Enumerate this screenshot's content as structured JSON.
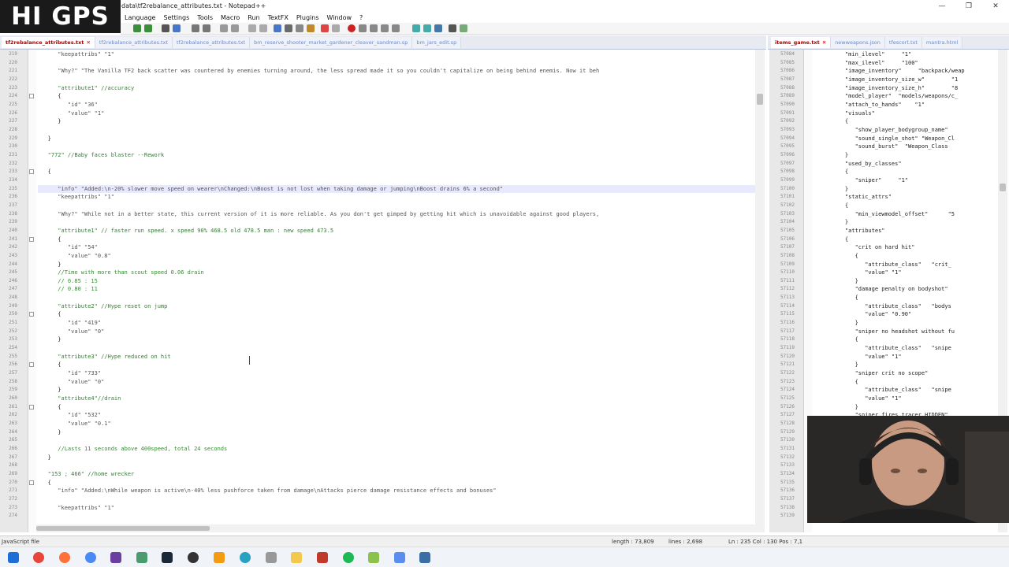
{
  "window": {
    "title": "data\\tf2rebalance_attributes.txt - Notepad++",
    "buttons": [
      "—",
      "❐",
      "✕"
    ]
  },
  "logo": {
    "text": "HI GPS"
  },
  "menu": [
    "Language",
    "Settings",
    "Tools",
    "Macro",
    "Run",
    "TextFX",
    "Plugins",
    "Window",
    "?"
  ],
  "left_tabs": [
    {
      "label": "tf2rebalance_attributes.txt",
      "active": true
    },
    {
      "label": "tf2rebalance_attributes.txt",
      "active": false
    },
    {
      "label": "tf2rebalance_attributes.txt",
      "active": false
    },
    {
      "label": "bm_reserve_shooter_market_gardener_cleaver_sandman.sp",
      "active": false
    },
    {
      "label": "bm_jars_edit.sp",
      "active": false
    }
  ],
  "right_tabs": [
    {
      "label": "items_game.txt",
      "active": true
    },
    {
      "label": "newweapons.json",
      "active": false
    },
    {
      "label": "tfescort.txt",
      "active": false
    },
    {
      "label": "mantra.html",
      "active": false
    }
  ],
  "left_code": [
    {
      "n": "219",
      "t": "      \"keepattribs\" \"1\"",
      "c": "str"
    },
    {
      "n": "220",
      "t": "",
      "c": ""
    },
    {
      "n": "221",
      "t": "      \"Why?\" \"The Vanilla TF2 back scatter was countered by enemies turning around, the less spread made it so you couldn't capitalize on being behind enemis. Now it beh",
      "c": "str"
    },
    {
      "n": "222",
      "t": "",
      "c": ""
    },
    {
      "n": "223",
      "t": "      \"attribute1\" //accuracy",
      "c": "mix1"
    },
    {
      "n": "224",
      "t": "      {",
      "c": ""
    },
    {
      "n": "225",
      "t": "         \"id\" \"36\"",
      "c": "str"
    },
    {
      "n": "226",
      "t": "         \"value\" \"1\"",
      "c": "str"
    },
    {
      "n": "227",
      "t": "      }",
      "c": ""
    },
    {
      "n": "228",
      "t": "",
      "c": ""
    },
    {
      "n": "229",
      "t": "   }",
      "c": ""
    },
    {
      "n": "230",
      "t": "",
      "c": ""
    },
    {
      "n": "231",
      "t": "   \"772\" //Baby faces blaster --Rework",
      "c": "mix1"
    },
    {
      "n": "232",
      "t": "",
      "c": ""
    },
    {
      "n": "233",
      "t": "   {",
      "c": ""
    },
    {
      "n": "234",
      "t": "",
      "c": ""
    },
    {
      "n": "235",
      "t": "      \"info\" \"Added:\\n-20% slower move speed on wearer\\nChanged:\\nBoost is not lost when taking damage or jumping\\nBoost drains 6% a second\"",
      "c": "str"
    },
    {
      "n": "236",
      "t": "      \"keepattribs\" \"1\"",
      "c": "str"
    },
    {
      "n": "237",
      "t": "",
      "c": ""
    },
    {
      "n": "238",
      "t": "      \"Why?\" \"While not in a better state, this current version of it is more reliable. As you don't get gimped by getting hit which is unavoidable against good players,",
      "c": "str"
    },
    {
      "n": "239",
      "t": "",
      "c": ""
    },
    {
      "n": "240",
      "t": "      \"attribute1\" // faster run speed. x speed 90% 468.5 old 478.5 man : new speed 473.5",
      "c": "mix1"
    },
    {
      "n": "241",
      "t": "      {",
      "c": ""
    },
    {
      "n": "242",
      "t": "         \"id\" \"54\"",
      "c": "str"
    },
    {
      "n": "243",
      "t": "         \"value\" \"0.8\"",
      "c": "str"
    },
    {
      "n": "244",
      "t": "      }",
      "c": ""
    },
    {
      "n": "245",
      "t": "      //Time with more than scout speed 0.06 drain",
      "c": "cmt"
    },
    {
      "n": "246",
      "t": "      // 0.85 : 15",
      "c": "cmt"
    },
    {
      "n": "247",
      "t": "      // 0.80 : 11",
      "c": "cmt"
    },
    {
      "n": "248",
      "t": "",
      "c": ""
    },
    {
      "n": "249",
      "t": "      \"attribute2\" //Hype reset on jump",
      "c": "mix1"
    },
    {
      "n": "250",
      "t": "      {",
      "c": ""
    },
    {
      "n": "251",
      "t": "         \"id\" \"419\"",
      "c": "str"
    },
    {
      "n": "252",
      "t": "         \"value\" \"0\"",
      "c": "str"
    },
    {
      "n": "253",
      "t": "      }",
      "c": ""
    },
    {
      "n": "254",
      "t": "",
      "c": ""
    },
    {
      "n": "255",
      "t": "      \"attribute3\" //Hype reduced on hit",
      "c": "mix1"
    },
    {
      "n": "256",
      "t": "      {",
      "c": ""
    },
    {
      "n": "257",
      "t": "         \"id\" \"733\"",
      "c": "str"
    },
    {
      "n": "258",
      "t": "         \"value\" \"0\"",
      "c": "str"
    },
    {
      "n": "259",
      "t": "      }",
      "c": ""
    },
    {
      "n": "260",
      "t": "      \"attribute4\"//drain",
      "c": "mix1"
    },
    {
      "n": "261",
      "t": "      {",
      "c": ""
    },
    {
      "n": "262",
      "t": "         \"id\" \"532\"",
      "c": "str"
    },
    {
      "n": "263",
      "t": "         \"value\" \"0.1\"",
      "c": "str"
    },
    {
      "n": "264",
      "t": "      }",
      "c": ""
    },
    {
      "n": "265",
      "t": "",
      "c": ""
    },
    {
      "n": "266",
      "t": "      //Lasts 11 seconds above 400speed, total 24 seconds",
      "c": "cmt"
    },
    {
      "n": "267",
      "t": "   }",
      "c": ""
    },
    {
      "n": "268",
      "t": "",
      "c": ""
    },
    {
      "n": "269",
      "t": "   \"153 ; 466\" //home wrecker",
      "c": "mix1"
    },
    {
      "n": "270",
      "t": "   {",
      "c": ""
    },
    {
      "n": "271",
      "t": "      \"info\" \"Added:\\nWhile weapon is active\\n-40% less pushforce taken from damage\\nAttacks pierce damage resistance effects and bonuses\"",
      "c": "str"
    },
    {
      "n": "272",
      "t": "",
      "c": ""
    },
    {
      "n": "273",
      "t": "      \"keepattribs\" \"1\"",
      "c": "str"
    },
    {
      "n": "274",
      "t": "",
      "c": ""
    }
  ],
  "right_code": [
    {
      "n": "57084",
      "t": "         \"min_ilevel\"     \"1\""
    },
    {
      "n": "57085",
      "t": "         \"max_ilevel\"     \"100\""
    },
    {
      "n": "57086",
      "t": "         \"image_inventory\"     \"backpack/weap"
    },
    {
      "n": "57087",
      "t": "         \"image_inventory_size_w\"        \"1"
    },
    {
      "n": "57088",
      "t": "         \"image_inventory_size_h\"        \"8"
    },
    {
      "n": "57089",
      "t": "         \"model_player\"  \"models/weapons/c_"
    },
    {
      "n": "57090",
      "t": "         \"attach_to_hands\"    \"1\""
    },
    {
      "n": "57091",
      "t": "         \"visuals\""
    },
    {
      "n": "57092",
      "t": "         {"
    },
    {
      "n": "57093",
      "t": "            \"show_player_bodygroup_name\""
    },
    {
      "n": "57094",
      "t": "            \"sound_single_shot\" \"Weapon_Cl"
    },
    {
      "n": "57095",
      "t": "            \"sound_burst\"  \"Weapon_Class"
    },
    {
      "n": "57096",
      "t": "         }"
    },
    {
      "n": "57097",
      "t": "         \"used_by_classes\""
    },
    {
      "n": "57098",
      "t": "         {"
    },
    {
      "n": "57099",
      "t": "            \"sniper\"     \"1\""
    },
    {
      "n": "57100",
      "t": "         }"
    },
    {
      "n": "57101",
      "t": "         \"static_attrs\""
    },
    {
      "n": "57102",
      "t": "         {"
    },
    {
      "n": "57103",
      "t": "            \"min_viewmodel_offset\"      \"5"
    },
    {
      "n": "57104",
      "t": "         }"
    },
    {
      "n": "57105",
      "t": "         \"attributes\""
    },
    {
      "n": "57106",
      "t": "         {"
    },
    {
      "n": "57107",
      "t": "            \"crit on hard hit\""
    },
    {
      "n": "57108",
      "t": "            {"
    },
    {
      "n": "57109",
      "t": "               \"attribute_class\"   \"crit_"
    },
    {
      "n": "57110",
      "t": "               \"value\" \"1\""
    },
    {
      "n": "57111",
      "t": "            }"
    },
    {
      "n": "57112",
      "t": "            \"damage penalty on bodyshot\""
    },
    {
      "n": "57113",
      "t": "            {"
    },
    {
      "n": "57114",
      "t": "               \"attribute_class\"   \"bodys"
    },
    {
      "n": "57115",
      "t": "               \"value\" \"0.90\""
    },
    {
      "n": "57116",
      "t": "            }"
    },
    {
      "n": "57117",
      "t": "            \"sniper no headshot without fu"
    },
    {
      "n": "57118",
      "t": "            {"
    },
    {
      "n": "57119",
      "t": "               \"attribute_class\"   \"snipe"
    },
    {
      "n": "57120",
      "t": "               \"value\" \"1\""
    },
    {
      "n": "57121",
      "t": "            }"
    },
    {
      "n": "57122",
      "t": "            \"sniper crit no scope\""
    },
    {
      "n": "57123",
      "t": "            {"
    },
    {
      "n": "57124",
      "t": "               \"attribute_class\"   \"snipe"
    },
    {
      "n": "57125",
      "t": "               \"value\" \"1\""
    },
    {
      "n": "57126",
      "t": "            }"
    },
    {
      "n": "57127",
      "t": "            \"sniper fires tracer HIDDEN\""
    },
    {
      "n": "57128",
      "t": "            {"
    },
    {
      "n": "57129",
      "t": "               \"attribute_class\"   \"snipe"
    },
    {
      "n": "57130",
      "t": ""
    },
    {
      "n": "57131",
      "t": ""
    },
    {
      "n": "57132",
      "t": ""
    },
    {
      "n": "57133",
      "t": ""
    },
    {
      "n": "57134",
      "t": ""
    },
    {
      "n": "57135",
      "t": ""
    },
    {
      "n": "57136",
      "t": ""
    },
    {
      "n": "57137",
      "t": ""
    },
    {
      "n": "57138",
      "t": ""
    },
    {
      "n": "57139",
      "t": ""
    }
  ],
  "status": {
    "file_type": "JavaScript file",
    "length": "length : 73,809",
    "lines": "lines : 2,698",
    "position": "Ln : 235    Col : 130    Pos : 7,1"
  },
  "colors": {
    "accent": "#a00000",
    "comment": "#2f8f2f",
    "tab_inactive": "#6b8bd0"
  }
}
